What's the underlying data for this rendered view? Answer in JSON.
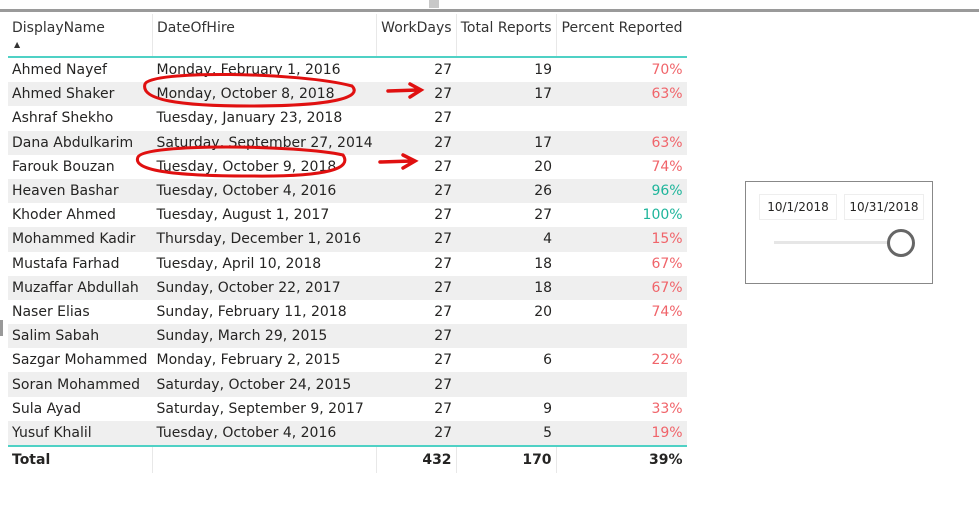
{
  "table": {
    "columns": [
      "DisplayName",
      "DateOfHire",
      "WorkDays",
      "Total Reports",
      "Percent Reported"
    ],
    "sort_indicator": "▲",
    "rows": [
      [
        "Ahmed Nayef",
        "Monday, February 1, 2016",
        "27",
        "19",
        "70%",
        "red"
      ],
      [
        "Ahmed Shaker",
        "Monday, October 8, 2018",
        "27",
        "17",
        "63%",
        "red"
      ],
      [
        "Ashraf Shekho",
        "Tuesday, January 23, 2018",
        "27",
        "",
        "",
        "red"
      ],
      [
        "Dana Abdulkarim",
        "Saturday, September 27, 2014",
        "27",
        "17",
        "63%",
        "red"
      ],
      [
        "Farouk Bouzan",
        "Tuesday, October 9, 2018",
        "27",
        "20",
        "74%",
        "red"
      ],
      [
        "Heaven Bashar",
        "Tuesday, October 4, 2016",
        "27",
        "26",
        "96%",
        "green"
      ],
      [
        "Khoder Ahmed",
        "Tuesday, August 1, 2017",
        "27",
        "27",
        "100%",
        "green"
      ],
      [
        "Mohammed Kadir",
        "Thursday, December 1, 2016",
        "27",
        "4",
        "15%",
        "red"
      ],
      [
        "Mustafa Farhad",
        "Tuesday, April 10, 2018",
        "27",
        "18",
        "67%",
        "red"
      ],
      [
        "Muzaffar Abdullah",
        "Sunday, October 22, 2017",
        "27",
        "18",
        "67%",
        "red"
      ],
      [
        "Naser Elias",
        "Sunday, February 11, 2018",
        "27",
        "20",
        "74%",
        "red"
      ],
      [
        "Salim Sabah",
        "Sunday, March 29, 2015",
        "27",
        "",
        "",
        "red"
      ],
      [
        "Sazgar Mohammed",
        "Monday, February 2, 2015",
        "27",
        "6",
        "22%",
        "red"
      ],
      [
        "Soran Mohammed",
        "Saturday, October 24, 2015",
        "27",
        "",
        "",
        "red"
      ],
      [
        "Sula Ayad",
        "Saturday, September 9, 2017",
        "27",
        "9",
        "33%",
        "red"
      ],
      [
        "Yusuf Khalil",
        "Tuesday, October 4, 2016",
        "27",
        "5",
        "19%",
        "red"
      ]
    ],
    "total": {
      "label": "Total",
      "workdays": "432",
      "reports": "170",
      "percent": "39%"
    }
  },
  "colors": {
    "red": "#f0646a",
    "green": "#1fb59b",
    "accent": "#4fd1c5",
    "annotation": "#e01010"
  },
  "slicer": {
    "start": "10/1/2018",
    "end": "10/31/2018",
    "position": 1.0
  }
}
